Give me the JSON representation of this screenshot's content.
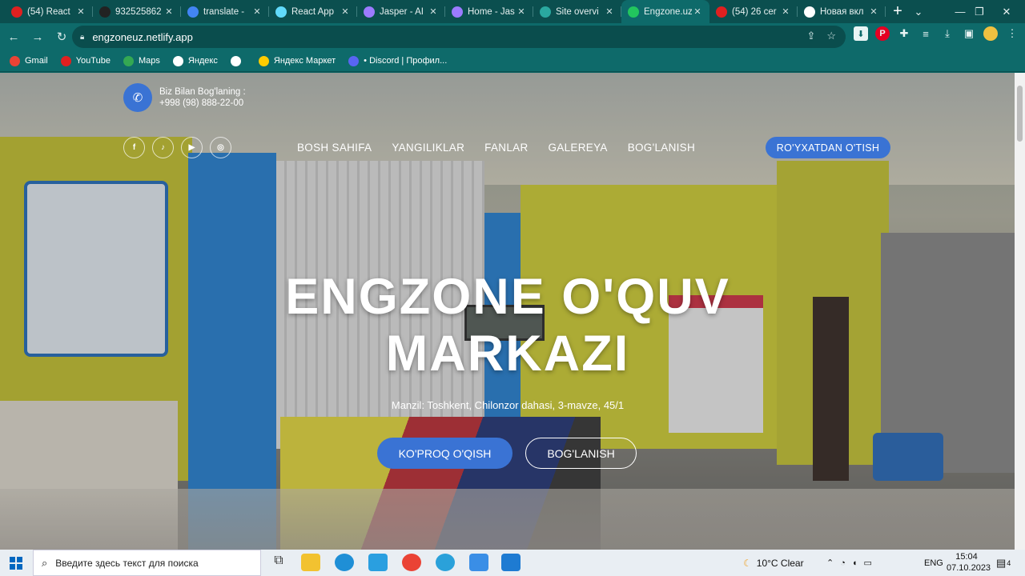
{
  "browser": {
    "tabs": [
      {
        "label": "(54) React",
        "color": "#e02020"
      },
      {
        "label": "932525862",
        "color": "#222222"
      },
      {
        "label": "translate -",
        "color": "#4285f4"
      },
      {
        "label": "React App",
        "color": "#61dafb"
      },
      {
        "label": "Jasper - AI",
        "color": "#9b7bff"
      },
      {
        "label": "Home - Jas",
        "color": "#9b7bff"
      },
      {
        "label": "Site overvi",
        "color": "#2aa8a0"
      },
      {
        "label": "Engzone.uz",
        "color": "#22c55e"
      },
      {
        "label": "(54) 26 cer",
        "color": "#e02020"
      },
      {
        "label": "Новая вкл",
        "color": "#ffffff"
      }
    ],
    "new_tab": "+",
    "url": "engzoneuz.netlify.app",
    "bookmarks": [
      {
        "label": "Gmail",
        "color": "#ea4335"
      },
      {
        "label": "YouTube",
        "color": "#e02020"
      },
      {
        "label": "Maps",
        "color": "#34a853"
      },
      {
        "label": "Яндекс",
        "color": "#ffffff"
      },
      {
        "label": "",
        "color": "#ffffff"
      },
      {
        "label": "Яндекс Маркет",
        "color": "#ffcc00"
      },
      {
        "label": "• Discord | Профил...",
        "color": "#5865f2"
      }
    ]
  },
  "site": {
    "contact_title": "Biz Bilan Bog'laning :",
    "contact_phone": "+998 (98) 888-22-00",
    "socials": [
      {
        "name": "facebook",
        "glyph": "f"
      },
      {
        "name": "tiktok",
        "glyph": "♪"
      },
      {
        "name": "youtube",
        "glyph": "▶"
      },
      {
        "name": "instagram",
        "glyph": "◎"
      }
    ],
    "nav": [
      "BOSH SAHIFA",
      "YANGILIKLAR",
      "FANLAR",
      "GALEREYA",
      "BOG'LANISH"
    ],
    "register_label": "RO'YXATDAN O'TISH",
    "title_line1": "ENGZONE O'QUV",
    "title_line2": "MARKAZI",
    "address": "Manzil: Toshkent, Chilonzor dahasi, 3-mavze, 45/1",
    "btn_more": "KO'PROQ O'QISH",
    "btn_contact": "BOG'LANISH"
  },
  "taskbar": {
    "search_placeholder": "Введите здесь текст для поиска",
    "weather": "10°C  Clear",
    "lang": "ENG",
    "time": "15:04",
    "date": "07.10.2023",
    "notifications": "4"
  },
  "colors": {
    "accent": "#3a73d4",
    "chrome": "#0e6a6a"
  }
}
